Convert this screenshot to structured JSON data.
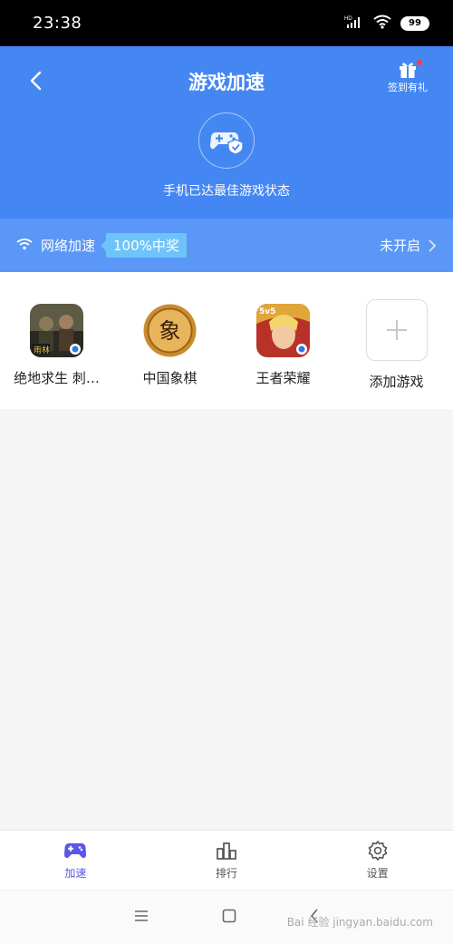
{
  "status_bar": {
    "time": "23:38",
    "battery": "99",
    "network": "HD"
  },
  "header": {
    "title": "游戏加速",
    "gift_label": "签到有礼",
    "status_message": "手机已达最佳游戏状态"
  },
  "network": {
    "label": "网络加速",
    "badge": "100%中奖",
    "status": "未开启"
  },
  "games": [
    {
      "name": "绝地求生 刺…",
      "badge": "雨林"
    },
    {
      "name": "中国象棋",
      "glyph": "象"
    },
    {
      "name": "王者荣耀",
      "badge": "5v5"
    },
    {
      "name": "添加游戏"
    }
  ],
  "tabs": [
    {
      "label": "加速",
      "active": true
    },
    {
      "label": "排行",
      "active": false
    },
    {
      "label": "设置",
      "active": false
    }
  ],
  "watermark": "Bai 经验 jingyan.baidu.com",
  "colors": {
    "primary": "#4587f2",
    "network_bar": "#5a97f6",
    "badge": "#6ec4f9",
    "active_tab": "#5a56e6"
  }
}
